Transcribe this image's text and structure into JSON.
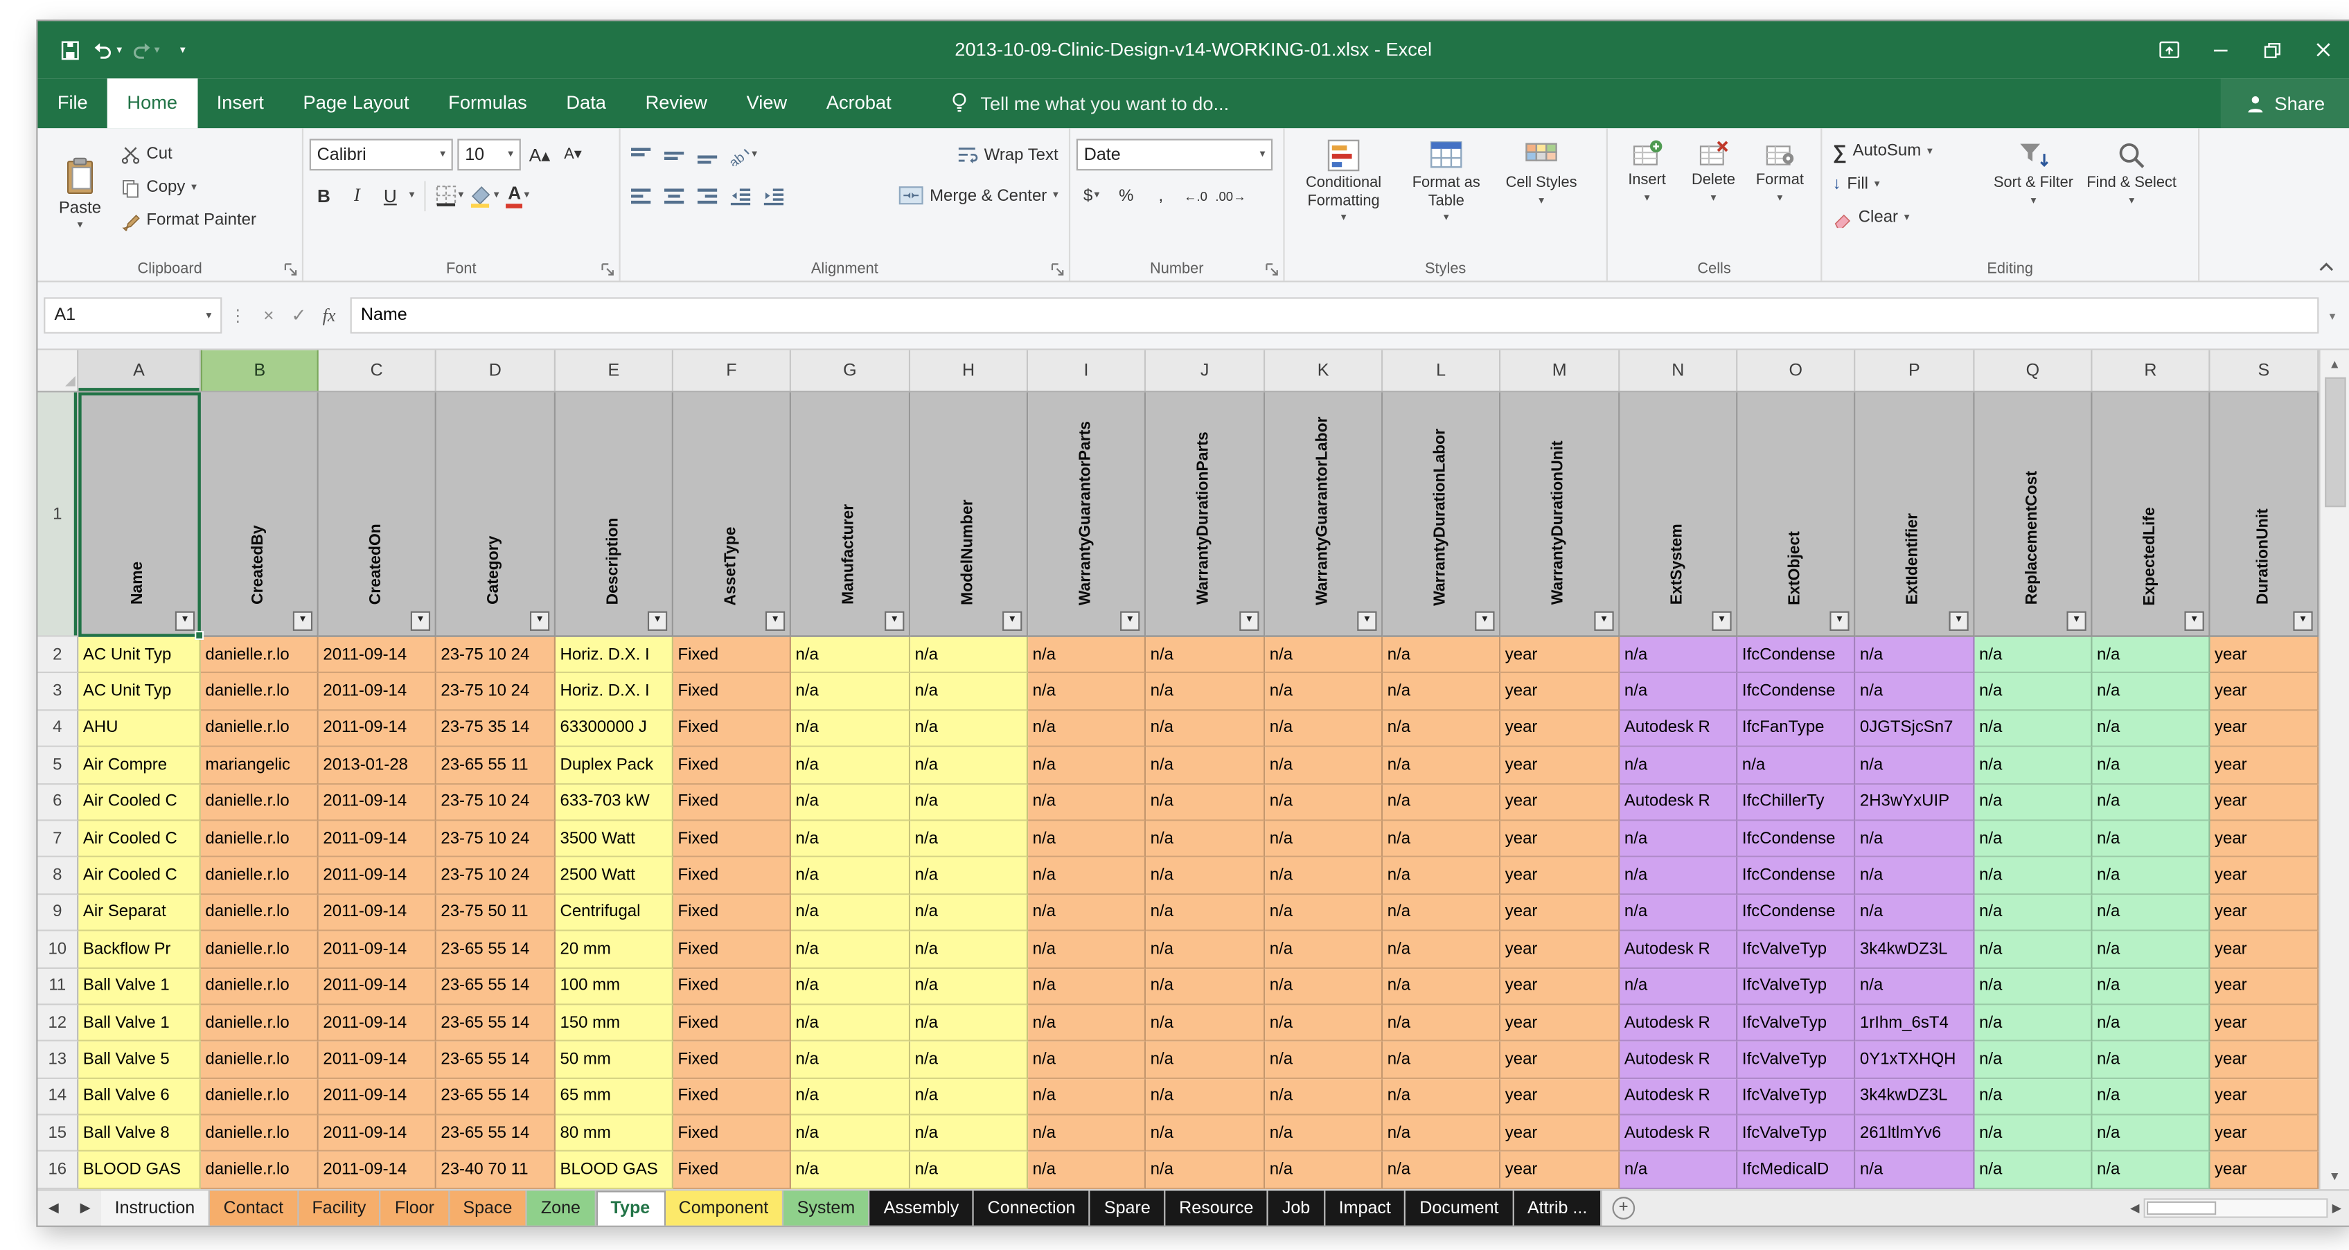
{
  "window": {
    "title": "2013-10-09-Clinic-Design-v14-WORKING-01.xlsx - Excel"
  },
  "menu": {
    "tabs": [
      "File",
      "Home",
      "Insert",
      "Page Layout",
      "Formulas",
      "Data",
      "Review",
      "View",
      "Acrobat"
    ],
    "active": "Home",
    "tell_me": "Tell me what you want to do...",
    "share": "Share"
  },
  "ribbon": {
    "clipboard": {
      "group": "Clipboard",
      "paste": "Paste",
      "cut": "Cut",
      "copy": "Copy",
      "format_painter": "Format Painter"
    },
    "font": {
      "group": "Font",
      "name": "Calibri",
      "size": "10",
      "bold": "B",
      "italic": "I",
      "underline": "U"
    },
    "alignment": {
      "group": "Alignment",
      "wrap": "Wrap Text",
      "merge": "Merge & Center"
    },
    "number": {
      "group": "Number",
      "format": "Date"
    },
    "styles": {
      "group": "Styles",
      "conditional": "Conditional Formatting",
      "format_table": "Format as Table",
      "cell_styles": "Cell Styles"
    },
    "cells": {
      "group": "Cells",
      "insert": "Insert",
      "delete": "Delete",
      "format": "Format"
    },
    "editing": {
      "group": "Editing",
      "autosum": "AutoSum",
      "fill": "Fill",
      "clear": "Clear",
      "sort": "Sort & Filter",
      "find": "Find & Select"
    }
  },
  "formula_bar": {
    "name_box": "A1",
    "fx": "fx",
    "content": "Name"
  },
  "icons": {
    "dropdown": "▾",
    "dots": "⋮",
    "cancel": "×",
    "enter": "✓",
    "autosum": "∑",
    "fill_down": "↓",
    "grow_font": "A▴",
    "shrink_font": "A▾",
    "orientation": "ab",
    "tab_prev": "◀",
    "tab_next": "▶",
    "add_sheet": "+",
    "scroll_left": "◀",
    "scroll_right": "▶",
    "scroll_up": "▲",
    "scroll_down": "▼",
    "select_all": "◢",
    "increase_decimal": "←.0",
    "decrease_decimal": ".00→",
    "currency": "$",
    "percent": "%",
    "comma": ","
  },
  "grid": {
    "active_cell": "A1",
    "active_column": "A",
    "highlighted_column": "B",
    "column_letters": [
      "A",
      "B",
      "C",
      "D",
      "E",
      "F",
      "G",
      "H",
      "I",
      "J",
      "K",
      "L",
      "M",
      "N",
      "O",
      "P",
      "Q",
      "R",
      "S"
    ],
    "header_labels": [
      "Name",
      "CreatedBy",
      "CreatedOn",
      "Category",
      "Description",
      "AssetType",
      "Manufacturer",
      "ModelNumber",
      "WarrantyGuarantorParts",
      "WarrantyDurationParts",
      "WarrantyGuarantorLabor",
      "WarrantyDurationLabor",
      "WarrantyDurationUnit",
      "ExtSystem",
      "ExtObject",
      "ExtIdentifier",
      "ReplacementCost",
      "ExpectedLife",
      "DurationUnit"
    ],
    "col_colors": [
      "yellow",
      "orange",
      "orange",
      "orange",
      "yellow",
      "orange",
      "yellow",
      "yellow",
      "orange",
      "orange",
      "orange",
      "orange",
      "orange",
      "purple",
      "purple",
      "purple",
      "green",
      "green",
      "orange"
    ],
    "rows": [
      {
        "n": 2,
        "cells": [
          "AC Unit Typ",
          "danielle.r.lo",
          "2011-09-14",
          "23-75 10 24",
          "Horiz. D.X. I",
          "Fixed",
          "n/a",
          "n/a",
          "n/a",
          "n/a",
          "n/a",
          "n/a",
          "year",
          "n/a",
          "IfcCondense",
          "n/a",
          "n/a",
          "n/a",
          "year"
        ]
      },
      {
        "n": 3,
        "cells": [
          "AC Unit Typ",
          "danielle.r.lo",
          "2011-09-14",
          "23-75 10 24",
          "Horiz. D.X. I",
          "Fixed",
          "n/a",
          "n/a",
          "n/a",
          "n/a",
          "n/a",
          "n/a",
          "year",
          "n/a",
          "IfcCondense",
          "n/a",
          "n/a",
          "n/a",
          "year"
        ]
      },
      {
        "n": 4,
        "cells": [
          "AHU",
          "danielle.r.lo",
          "2011-09-14",
          "23-75 35 14",
          "63300000 J",
          "Fixed",
          "n/a",
          "n/a",
          "n/a",
          "n/a",
          "n/a",
          "n/a",
          "year",
          "Autodesk R",
          "IfcFanType",
          "0JGTSjcSn7",
          "n/a",
          "n/a",
          "year"
        ]
      },
      {
        "n": 5,
        "cells": [
          "Air Compre",
          "mariangelic",
          "2013-01-28",
          "23-65 55 11",
          "Duplex Pack",
          "Fixed",
          "n/a",
          "n/a",
          "n/a",
          "n/a",
          "n/a",
          "n/a",
          "year",
          "n/a",
          "n/a",
          "n/a",
          "n/a",
          "n/a",
          "year"
        ]
      },
      {
        "n": 6,
        "cells": [
          "Air Cooled C",
          "danielle.r.lo",
          "2011-09-14",
          "23-75 10 24",
          "633-703 kW",
          "Fixed",
          "n/a",
          "n/a",
          "n/a",
          "n/a",
          "n/a",
          "n/a",
          "year",
          "Autodesk R",
          "IfcChillerTy",
          "2H3wYxUIP",
          "n/a",
          "n/a",
          "year"
        ]
      },
      {
        "n": 7,
        "cells": [
          "Air Cooled C",
          "danielle.r.lo",
          "2011-09-14",
          "23-75 10 24",
          "3500 Watt",
          "Fixed",
          "n/a",
          "n/a",
          "n/a",
          "n/a",
          "n/a",
          "n/a",
          "year",
          "n/a",
          "IfcCondense",
          "n/a",
          "n/a",
          "n/a",
          "year"
        ]
      },
      {
        "n": 8,
        "cells": [
          "Air Cooled C",
          "danielle.r.lo",
          "2011-09-14",
          "23-75 10 24",
          "2500 Watt",
          "Fixed",
          "n/a",
          "n/a",
          "n/a",
          "n/a",
          "n/a",
          "n/a",
          "year",
          "n/a",
          "IfcCondense",
          "n/a",
          "n/a",
          "n/a",
          "year"
        ]
      },
      {
        "n": 9,
        "cells": [
          "Air Separat",
          "danielle.r.lo",
          "2011-09-14",
          "23-75 50 11",
          "Centrifugal",
          "Fixed",
          "n/a",
          "n/a",
          "n/a",
          "n/a",
          "n/a",
          "n/a",
          "year",
          "n/a",
          "IfcCondense",
          "n/a",
          "n/a",
          "n/a",
          "year"
        ]
      },
      {
        "n": 10,
        "cells": [
          "Backflow Pr",
          "danielle.r.lo",
          "2011-09-14",
          "23-65 55 14",
          "20 mm",
          "Fixed",
          "n/a",
          "n/a",
          "n/a",
          "n/a",
          "n/a",
          "n/a",
          "year",
          "Autodesk R",
          "IfcValveTyp",
          "3k4kwDZ3L",
          "n/a",
          "n/a",
          "year"
        ]
      },
      {
        "n": 11,
        "cells": [
          "Ball Valve 1",
          "danielle.r.lo",
          "2011-09-14",
          "23-65 55 14",
          "100 mm",
          "Fixed",
          "n/a",
          "n/a",
          "n/a",
          "n/a",
          "n/a",
          "n/a",
          "year",
          "n/a",
          "IfcValveTyp",
          "n/a",
          "n/a",
          "n/a",
          "year"
        ]
      },
      {
        "n": 12,
        "cells": [
          "Ball Valve 1",
          "danielle.r.lo",
          "2011-09-14",
          "23-65 55 14",
          "150 mm",
          "Fixed",
          "n/a",
          "n/a",
          "n/a",
          "n/a",
          "n/a",
          "n/a",
          "year",
          "Autodesk R",
          "IfcValveTyp",
          "1rIhm_6sT4",
          "n/a",
          "n/a",
          "year"
        ]
      },
      {
        "n": 13,
        "cells": [
          "Ball Valve 5",
          "danielle.r.lo",
          "2011-09-14",
          "23-65 55 14",
          "50 mm",
          "Fixed",
          "n/a",
          "n/a",
          "n/a",
          "n/a",
          "n/a",
          "n/a",
          "year",
          "Autodesk R",
          "IfcValveTyp",
          "0Y1xTXHQH",
          "n/a",
          "n/a",
          "year"
        ]
      },
      {
        "n": 14,
        "cells": [
          "Ball Valve 6",
          "danielle.r.lo",
          "2011-09-14",
          "23-65 55 14",
          "65 mm",
          "Fixed",
          "n/a",
          "n/a",
          "n/a",
          "n/a",
          "n/a",
          "n/a",
          "year",
          "Autodesk R",
          "IfcValveTyp",
          "3k4kwDZ3L",
          "n/a",
          "n/a",
          "year"
        ]
      },
      {
        "n": 15,
        "cells": [
          "Ball Valve 8",
          "danielle.r.lo",
          "2011-09-14",
          "23-65 55 14",
          "80 mm",
          "Fixed",
          "n/a",
          "n/a",
          "n/a",
          "n/a",
          "n/a",
          "n/a",
          "year",
          "Autodesk R",
          "IfcValveTyp",
          "261ltlmYv6",
          "n/a",
          "n/a",
          "year"
        ]
      },
      {
        "n": 16,
        "cells": [
          "BLOOD GAS",
          "danielle.r.lo",
          "2011-09-14",
          "23-40 70 11",
          "BLOOD GAS",
          "Fixed",
          "n/a",
          "n/a",
          "n/a",
          "n/a",
          "n/a",
          "n/a",
          "year",
          "n/a",
          "IfcMedicalD",
          "n/a",
          "n/a",
          "n/a",
          "year"
        ]
      }
    ]
  },
  "sheet_tabs": [
    {
      "label": "Instruction",
      "style": "plain"
    },
    {
      "label": "Contact",
      "style": "orange"
    },
    {
      "label": "Facility",
      "style": "orange"
    },
    {
      "label": "Floor",
      "style": "orange"
    },
    {
      "label": "Space",
      "style": "orange"
    },
    {
      "label": "Zone",
      "style": "green"
    },
    {
      "label": "Type",
      "style": "active"
    },
    {
      "label": "Component",
      "style": "yellow"
    },
    {
      "label": "System",
      "style": "green"
    },
    {
      "label": "Assembly",
      "style": "black"
    },
    {
      "label": "Connection",
      "style": "black"
    },
    {
      "label": "Spare",
      "style": "black"
    },
    {
      "label": "Resource",
      "style": "black"
    },
    {
      "label": "Job",
      "style": "black"
    },
    {
      "label": "Impact",
      "style": "black"
    },
    {
      "label": "Document",
      "style": "black"
    },
    {
      "label": "Attrib ...",
      "style": "black"
    }
  ],
  "palette": {
    "accent": "#217346",
    "titlebar": "#217346",
    "yellow": "#FFFC9E",
    "orange": "#FBC18C",
    "purple": "#D0A3F0",
    "green": "#B7F2C6",
    "header_gray": "#BFBFBF",
    "tab_orange": "#F6AE6B",
    "tab_green": "#8FD08B",
    "tab_yellow": "#FCE96A",
    "tab_black": "#181818"
  }
}
